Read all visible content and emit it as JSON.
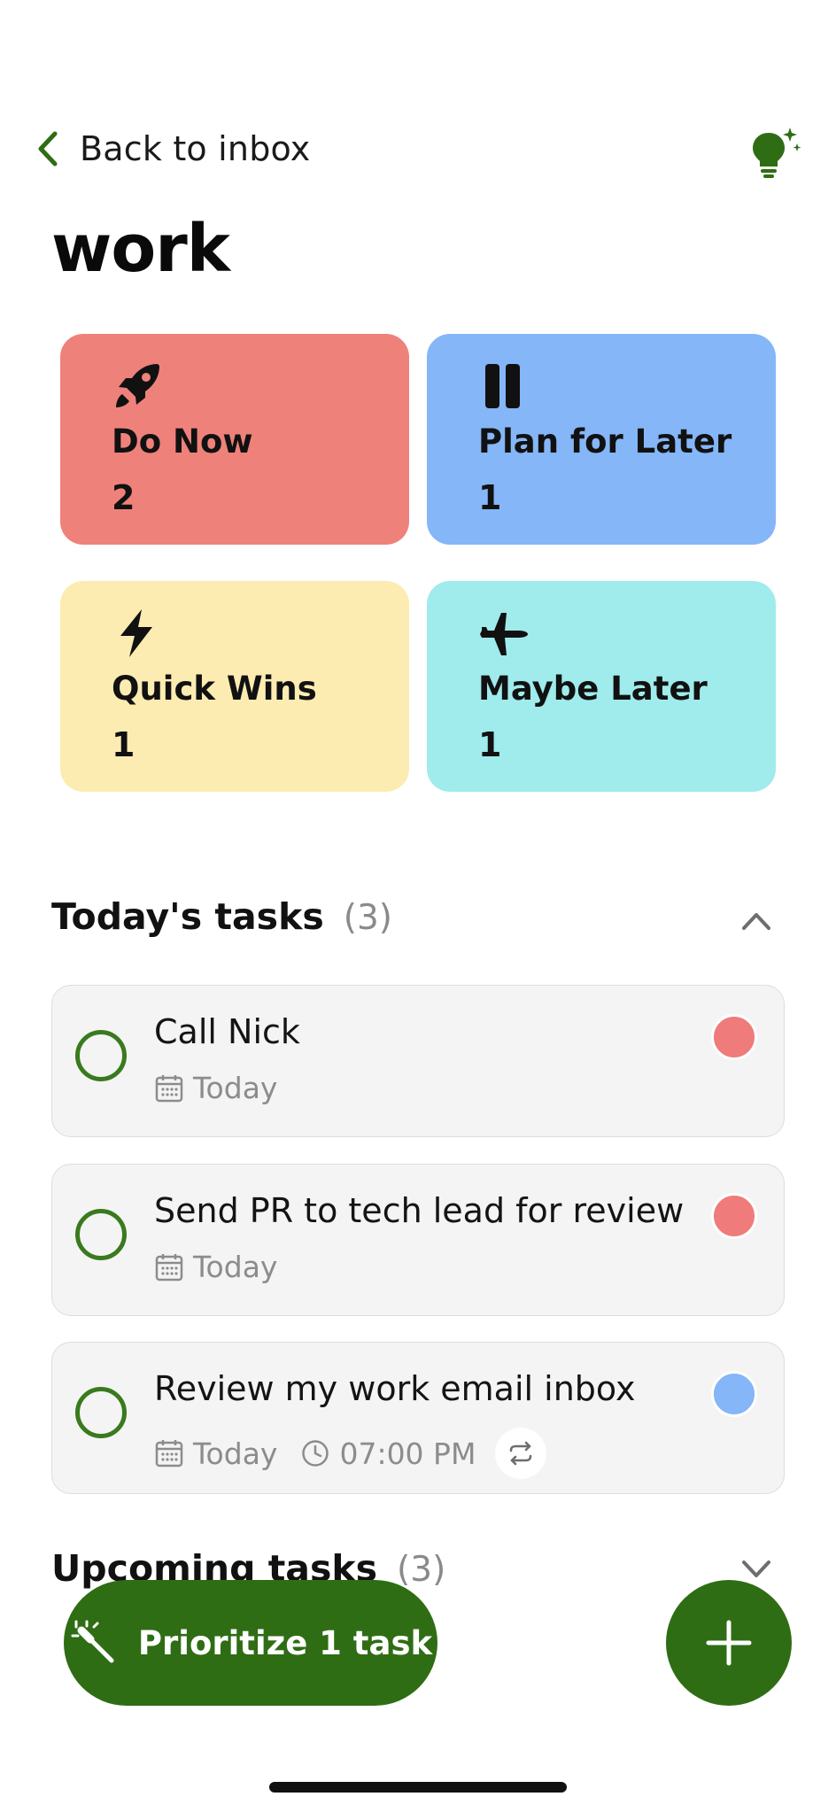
{
  "header": {
    "back_label": "Back to inbox",
    "title": "work"
  },
  "quadrants": [
    {
      "name": "Do Now",
      "count": "2",
      "icon": "rocket-icon",
      "color": "#ef817b"
    },
    {
      "name": "Plan for Later",
      "count": "1",
      "icon": "pause-icon",
      "color": "#85b6f7"
    },
    {
      "name": "Quick Wins",
      "count": "1",
      "icon": "lightning-icon",
      "color": "#fcecb2"
    },
    {
      "name": "Maybe Later",
      "count": "1",
      "icon": "airplane-icon",
      "color": "#a0ebeb"
    }
  ],
  "today": {
    "title": "Today's tasks",
    "count": "(3)",
    "tasks": [
      {
        "title": "Call Nick",
        "date": "Today",
        "priority_color": "#ef7c7a"
      },
      {
        "title": "Send PR to tech lead for review",
        "date": "Today",
        "priority_color": "#ef7c7a"
      },
      {
        "title": "Review my work email inbox",
        "date": "Today",
        "time": "07:00 PM",
        "repeat": true,
        "priority_color": "#85b6f7"
      }
    ]
  },
  "upcoming": {
    "title": "Upcoming tasks",
    "count": "(3)"
  },
  "actions": {
    "prioritize_label": "Prioritize 1 task"
  },
  "colors": {
    "accent": "#2f6d14"
  }
}
